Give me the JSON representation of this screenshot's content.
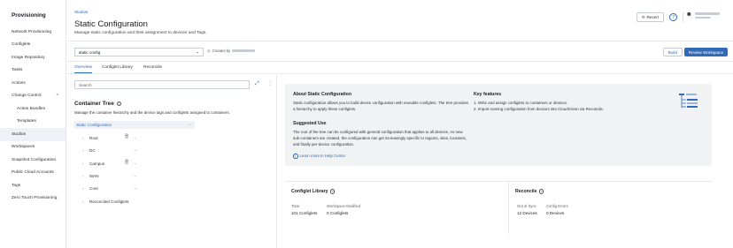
{
  "sidebar": {
    "title": "Provisioning",
    "items": [
      {
        "label": "Network Provisioning"
      },
      {
        "label": "Configlets"
      },
      {
        "label": "Image Repository"
      },
      {
        "label": "Tasks"
      },
      {
        "label": "Actions"
      },
      {
        "label": "Change Control",
        "chevron": "^"
      },
      {
        "label": "Action Bundles"
      },
      {
        "label": "Templates"
      },
      {
        "label": "Studios"
      },
      {
        "label": "Workspaces"
      },
      {
        "label": "Snapshot Configuration"
      },
      {
        "label": "Public Cloud Accounts"
      },
      {
        "label": "Tags"
      },
      {
        "label": "Zero Touch Provisioning"
      }
    ],
    "active_index": 8
  },
  "header": {
    "breadcrumb": "Studios",
    "title": "Static Configuration",
    "subtitle": "Manage static configuration and their assignment to devices and Tags.",
    "revert_label": "Revert",
    "help_label": "?"
  },
  "toolbar": {
    "workspace_value": "static config",
    "created_by_label": "Created by",
    "build_label": "Build",
    "review_label": "Review Workspace"
  },
  "tabs": [
    {
      "label": "Overview",
      "active": true
    },
    {
      "label": "Configlet Library",
      "active": false
    },
    {
      "label": "Reconcile",
      "active": false
    }
  ],
  "left": {
    "search_placeholder": "Search",
    "tree_title": "Container Tree",
    "tree_desc": "Manage the container hierarchy and the device tags and configlets assigned to containers.",
    "root_label": "Static Configuration",
    "root_menu": "···",
    "rows": [
      {
        "label": "Root",
        "has_doc": true,
        "menu": "···"
      },
      {
        "label": "DC",
        "has_doc": false,
        "menu": "···"
      },
      {
        "label": "Campus",
        "has_doc": true,
        "menu": "···"
      },
      {
        "label": "WAN",
        "has_doc": false,
        "menu": "···"
      },
      {
        "label": "Core",
        "has_doc": false,
        "menu": "···"
      },
      {
        "label": "Reconciled Configlets",
        "has_doc": false,
        "menu": ""
      }
    ]
  },
  "about": {
    "title": "About Static Configuration",
    "body": "Static configuration allows you to build device configuration with reusable configlets. The tree provides a hierarchy to apply these configlets.",
    "suggested_title": "Suggested Use",
    "suggested_body": "The root of the tree can be configured with general configuration that applies to all devices. As new sub-containers are created, the configuration can get increasingly specific to regions, sites, locations, and finally per-device configuration.",
    "link": "Learn more in Help Center",
    "features_title": "Key features",
    "features": [
      "1.  Write and assign configlets to containers or devices.",
      "2.  Import running configuration from devices into CloudVision via Reconcile."
    ]
  },
  "library": {
    "title": "Configlet Library",
    "total_label": "Total",
    "total_value": "101 Configlets",
    "ws_label": "Workspace-Modified",
    "ws_value": "0 Configlets"
  },
  "reconcile": {
    "title": "Reconcile",
    "oos_label": "Out of Sync",
    "oos_value": "12 Devices",
    "cd_label": "Config Errors",
    "cd_value": "0 Devices"
  },
  "colors": {
    "accent": "#2f6bb8",
    "panel": "#f0f2f4"
  }
}
